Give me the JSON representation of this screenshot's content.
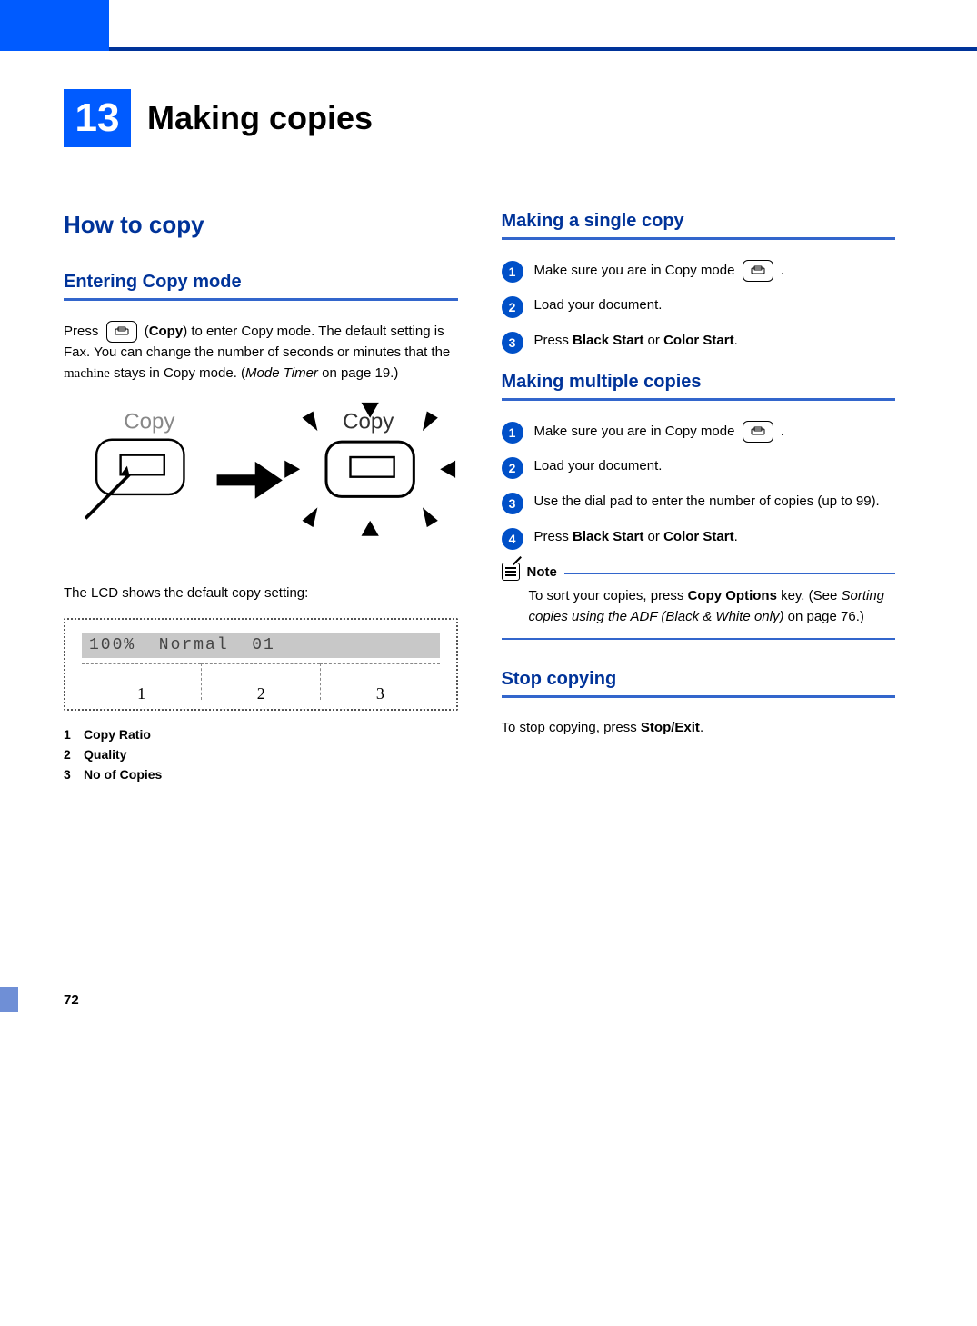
{
  "page_number": "72",
  "chapter": {
    "num": "13",
    "title": "Making copies"
  },
  "left": {
    "h2": "How to copy",
    "h3": "Entering Copy mode",
    "p1_a": "Press ",
    "p1_b": " (",
    "p1_copy": "Copy",
    "p1_c": ") to enter Copy mode. The default setting is Fax. You can change the number of seconds or minutes that the ",
    "p1_machine": "machine",
    "p1_d": " stays in Copy mode. (",
    "p1_ital": "Mode Timer",
    "p1_e": " on page 19.)",
    "illus_label": "Copy",
    "lcd_intro": "The LCD shows the default copy setting:",
    "lcd_text": "100%  Normal  01",
    "lcd_nums": {
      "n1": "1",
      "n2": "2",
      "n3": "3"
    },
    "legend": {
      "l1n": "1",
      "l1t": "Copy Ratio",
      "l2n": "2",
      "l2t": "Quality",
      "l3n": "3",
      "l3t": "No of Copies"
    }
  },
  "right": {
    "single": {
      "h3": "Making a single copy",
      "s1": "Make sure you are in Copy mode ",
      "s1_end": " .",
      "s2": "Load your document.",
      "s3a": "Press ",
      "s3b": "Black Start",
      "s3c": " or ",
      "s3d": "Color Start",
      "s3e": "."
    },
    "multi": {
      "h3": "Making multiple copies",
      "s1": "Make sure you are in Copy mode ",
      "s1_end": " .",
      "s2": "Load your document.",
      "s3": "Use the dial pad to enter the number of copies (up to 99).",
      "s4a": "Press ",
      "s4b": "Black Start",
      "s4c": " or ",
      "s4d": "Color Start",
      "s4e": "."
    },
    "note": {
      "title": "Note",
      "b1": "To sort your copies, press ",
      "b2": "Copy Options",
      "b3": " key. (See ",
      "b4": "Sorting copies using the ADF (Black & White only)",
      "b5": " on page 76.)"
    },
    "stop": {
      "h3": "Stop copying",
      "p1a": "To stop copying, press ",
      "p1b": "Stop/Exit",
      "p1c": "."
    }
  },
  "bullets": {
    "b1": "1",
    "b2": "2",
    "b3": "3",
    "b4": "4"
  }
}
